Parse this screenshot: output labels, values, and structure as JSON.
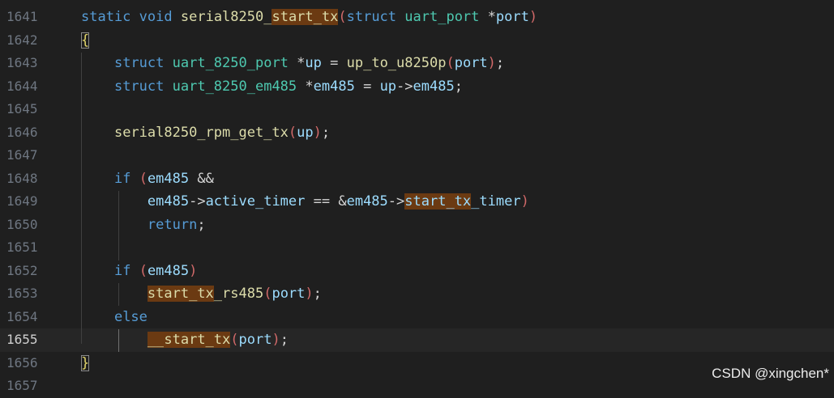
{
  "editor": {
    "language": "c",
    "current_line_number": "1655",
    "colors": {
      "background": "#1f1f1f",
      "keyword": "#569cd6",
      "type": "#4ec9b0",
      "function": "#dcdcaa",
      "variable": "#9cdcfe",
      "plain": "#d4d4d4",
      "paren": "#d16969",
      "brace": "#e0d46a",
      "line_number": "#6e7681",
      "find_match_highlight": "#6b3a12"
    },
    "lines": [
      {
        "number": "1641",
        "tokens": [
          {
            "t": "static",
            "c": "keyword"
          },
          {
            "t": " ",
            "c": "plain"
          },
          {
            "t": "void",
            "c": "keyword"
          },
          {
            "t": " ",
            "c": "plain"
          },
          {
            "t": "serial8250_",
            "c": "function"
          },
          {
            "t": "start_tx",
            "c": "function",
            "hl": true
          },
          {
            "t": "(",
            "c": "paren"
          },
          {
            "t": "struct",
            "c": "keyword"
          },
          {
            "t": " ",
            "c": "plain"
          },
          {
            "t": "uart_port",
            "c": "type"
          },
          {
            "t": " ",
            "c": "plain"
          },
          {
            "t": "*",
            "c": "plain"
          },
          {
            "t": "port",
            "c": "variable"
          },
          {
            "t": ")",
            "c": "paren"
          }
        ]
      },
      {
        "number": "1642",
        "tokens": [
          {
            "t": "{",
            "c": "brace",
            "box": true
          }
        ]
      },
      {
        "number": "1643",
        "tokens": [
          {
            "t": "    ",
            "c": "plain"
          },
          {
            "t": "struct",
            "c": "keyword"
          },
          {
            "t": " ",
            "c": "plain"
          },
          {
            "t": "uart_8250_port",
            "c": "type"
          },
          {
            "t": " ",
            "c": "plain"
          },
          {
            "t": "*",
            "c": "plain"
          },
          {
            "t": "up",
            "c": "variable"
          },
          {
            "t": " = ",
            "c": "plain"
          },
          {
            "t": "up_to_u8250p",
            "c": "function"
          },
          {
            "t": "(",
            "c": "paren"
          },
          {
            "t": "port",
            "c": "variable"
          },
          {
            "t": ")",
            "c": "paren"
          },
          {
            "t": ";",
            "c": "plain"
          }
        ]
      },
      {
        "number": "1644",
        "tokens": [
          {
            "t": "    ",
            "c": "plain"
          },
          {
            "t": "struct",
            "c": "keyword"
          },
          {
            "t": " ",
            "c": "plain"
          },
          {
            "t": "uart_8250_em485",
            "c": "type"
          },
          {
            "t": " ",
            "c": "plain"
          },
          {
            "t": "*",
            "c": "plain"
          },
          {
            "t": "em485",
            "c": "variable"
          },
          {
            "t": " = ",
            "c": "plain"
          },
          {
            "t": "up",
            "c": "variable"
          },
          {
            "t": "->",
            "c": "plain"
          },
          {
            "t": "em485",
            "c": "variable"
          },
          {
            "t": ";",
            "c": "plain"
          }
        ]
      },
      {
        "number": "1645",
        "tokens": []
      },
      {
        "number": "1646",
        "tokens": [
          {
            "t": "    ",
            "c": "plain"
          },
          {
            "t": "serial8250_rpm_get_tx",
            "c": "function"
          },
          {
            "t": "(",
            "c": "paren"
          },
          {
            "t": "up",
            "c": "variable"
          },
          {
            "t": ")",
            "c": "paren"
          },
          {
            "t": ";",
            "c": "plain"
          }
        ]
      },
      {
        "number": "1647",
        "tokens": []
      },
      {
        "number": "1648",
        "tokens": [
          {
            "t": "    ",
            "c": "plain"
          },
          {
            "t": "if",
            "c": "keyword"
          },
          {
            "t": " ",
            "c": "plain"
          },
          {
            "t": "(",
            "c": "paren"
          },
          {
            "t": "em485",
            "c": "variable"
          },
          {
            "t": " &&",
            "c": "plain"
          }
        ]
      },
      {
        "number": "1649",
        "tokens": [
          {
            "t": "        ",
            "c": "plain"
          },
          {
            "t": "em485",
            "c": "variable"
          },
          {
            "t": "->",
            "c": "plain"
          },
          {
            "t": "active_timer",
            "c": "variable"
          },
          {
            "t": " == ",
            "c": "plain"
          },
          {
            "t": "&",
            "c": "plain"
          },
          {
            "t": "em485",
            "c": "variable"
          },
          {
            "t": "->",
            "c": "plain"
          },
          {
            "t": "start_tx",
            "c": "variable",
            "hl": true
          },
          {
            "t": "_timer",
            "c": "variable"
          },
          {
            "t": ")",
            "c": "paren"
          }
        ]
      },
      {
        "number": "1650",
        "tokens": [
          {
            "t": "        ",
            "c": "plain"
          },
          {
            "t": "return",
            "c": "keyword"
          },
          {
            "t": ";",
            "c": "plain"
          }
        ]
      },
      {
        "number": "1651",
        "tokens": []
      },
      {
        "number": "1652",
        "tokens": [
          {
            "t": "    ",
            "c": "plain"
          },
          {
            "t": "if",
            "c": "keyword"
          },
          {
            "t": " ",
            "c": "plain"
          },
          {
            "t": "(",
            "c": "paren"
          },
          {
            "t": "em485",
            "c": "variable"
          },
          {
            "t": ")",
            "c": "paren"
          }
        ]
      },
      {
        "number": "1653",
        "tokens": [
          {
            "t": "        ",
            "c": "plain"
          },
          {
            "t": "start_tx",
            "c": "function",
            "hl": true
          },
          {
            "t": "_rs485",
            "c": "function"
          },
          {
            "t": "(",
            "c": "paren"
          },
          {
            "t": "port",
            "c": "variable"
          },
          {
            "t": ")",
            "c": "paren"
          },
          {
            "t": ";",
            "c": "plain"
          }
        ]
      },
      {
        "number": "1654",
        "tokens": [
          {
            "t": "    ",
            "c": "plain"
          },
          {
            "t": "else",
            "c": "keyword"
          }
        ]
      },
      {
        "number": "1655",
        "tokens": [
          {
            "t": "        ",
            "c": "plain"
          },
          {
            "t": "__",
            "c": "function",
            "hl": true
          },
          {
            "t": "start_tx",
            "c": "function",
            "hl": true
          },
          {
            "t": "(",
            "c": "paren"
          },
          {
            "t": "port",
            "c": "variable"
          },
          {
            "t": ")",
            "c": "paren"
          },
          {
            "t": ";",
            "c": "plain"
          }
        ]
      },
      {
        "number": "1656",
        "tokens": [
          {
            "t": "}",
            "c": "brace",
            "box": true
          }
        ]
      },
      {
        "number": "1657",
        "tokens": []
      }
    ]
  },
  "watermark": "CSDN @xingchen*"
}
